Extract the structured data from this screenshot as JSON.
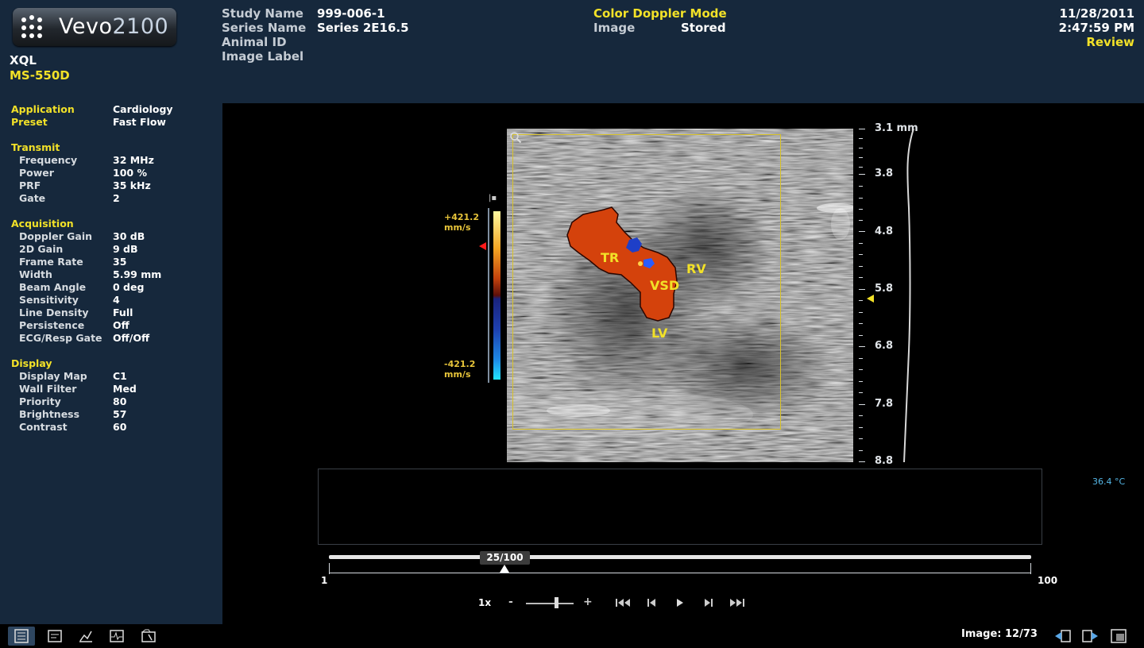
{
  "app": {
    "logo_name": "Vevo",
    "logo_model": "2100",
    "system_line1": "XQL",
    "system_line2": "MS-550D"
  },
  "study": {
    "labels": [
      "Study Name",
      "Series Name",
      "Animal ID",
      "Image Label"
    ],
    "values": [
      "999-006-1",
      "Series 2E16.5",
      "",
      ""
    ]
  },
  "mode": {
    "title": "Color Doppler Mode",
    "image_label": "Image",
    "image_value": "Stored"
  },
  "datetime": {
    "date": "11/28/2011",
    "time": "2:47:59 PM",
    "status": "Review"
  },
  "params": {
    "application": {
      "label": "Application",
      "value": "Cardiology"
    },
    "preset": {
      "label": "Preset",
      "value": "Fast Flow"
    },
    "transmit": {
      "title": "Transmit",
      "items": [
        {
          "k": "Frequency",
          "v": "32 MHz"
        },
        {
          "k": "Power",
          "v": "100 %"
        },
        {
          "k": "PRF",
          "v": "35 kHz"
        },
        {
          "k": "Gate",
          "v": "2"
        }
      ]
    },
    "acquisition": {
      "title": "Acquisition",
      "items": [
        {
          "k": "Doppler Gain",
          "v": "30 dB"
        },
        {
          "k": "2D Gain",
          "v": "9 dB"
        },
        {
          "k": "Frame Rate",
          "v": "35"
        },
        {
          "k": "Width",
          "v": "5.99 mm"
        },
        {
          "k": "Beam Angle",
          "v": "0 deg"
        },
        {
          "k": "Sensitivity",
          "v": "4"
        },
        {
          "k": "Line Density",
          "v": "Full"
        },
        {
          "k": "Persistence",
          "v": "Off"
        },
        {
          "k": "ECG/Resp Gate",
          "v": "Off/Off"
        }
      ]
    },
    "display": {
      "title": "Display",
      "items": [
        {
          "k": "Display Map",
          "v": "C1"
        },
        {
          "k": "Wall Filter",
          "v": "Med"
        },
        {
          "k": "Priority",
          "v": "80"
        },
        {
          "k": "Brightness",
          "v": "57"
        },
        {
          "k": "Contrast",
          "v": "60"
        }
      ]
    }
  },
  "colorbar": {
    "top_value": "+421.2",
    "top_unit": "mm/s",
    "bottom_value": "-421.2",
    "bottom_unit": "mm/s"
  },
  "annotations": {
    "tr": "TR",
    "rv": "RV",
    "vsd": "VSD",
    "lv": "LV"
  },
  "depth_scale": [
    "3.1 mm",
    "3.8",
    "4.8",
    "5.8",
    "6.8",
    "7.8",
    "8.8"
  ],
  "temperature": "36.4 °C",
  "cine": {
    "frame_label": "25/100",
    "frame_position": 0.25,
    "start": "1",
    "end": "100",
    "speed": "1x",
    "speed_min": "-",
    "speed_max": "+"
  },
  "image_counter": "Image: 12/73",
  "icons": [
    "study-list-icon",
    "measurement-icon",
    "analysis-icon",
    "physio-icon",
    "tools-icon",
    "previous-image-icon",
    "next-image-icon",
    "layout-icon",
    "first-frame-icon",
    "previous-frame-icon",
    "play-icon",
    "next-frame-icon",
    "last-frame-icon",
    "zoom-icon"
  ],
  "colors": {
    "accent_yellow": "#f2e128",
    "panel_bg": "#16283c",
    "temperature": "#55b8e8",
    "doppler_flow": "#d4420c"
  }
}
